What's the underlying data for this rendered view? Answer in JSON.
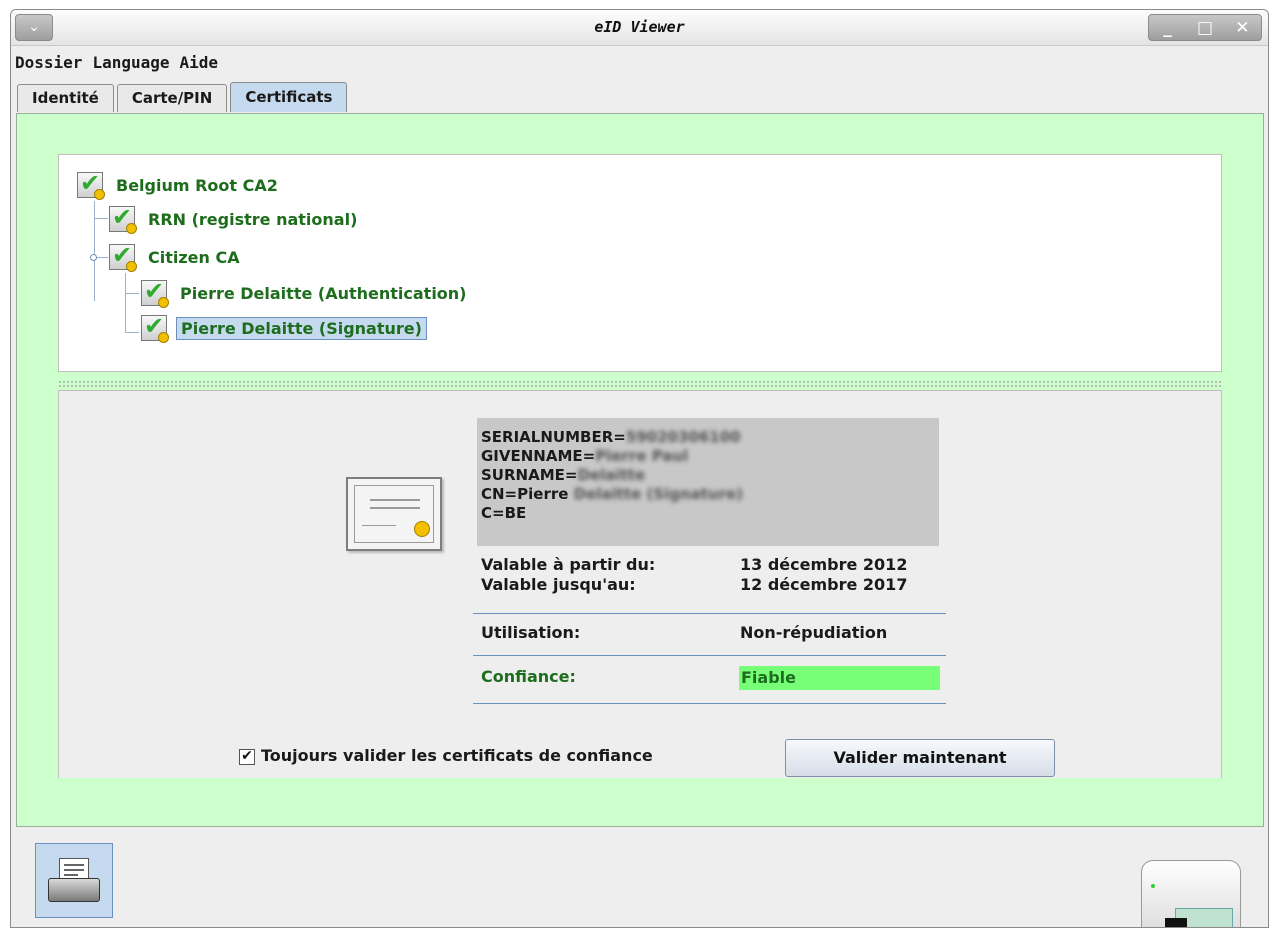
{
  "window": {
    "title": "eID Viewer",
    "menu_button_glyph": "⌄",
    "wm": {
      "minimize": "_",
      "maximize": "□",
      "close": "✕"
    }
  },
  "menubar": {
    "items": [
      "Dossier",
      "Language",
      "Aide"
    ]
  },
  "tabs": [
    {
      "label": "Identité",
      "active": false
    },
    {
      "label": "Carte/PIN",
      "active": false
    },
    {
      "label": "Certificats",
      "active": true
    }
  ],
  "tree": {
    "items": [
      {
        "label": "Belgium Root CA2",
        "level": 0,
        "icon": "cert-valid-icon"
      },
      {
        "label": "RRN (registre national)",
        "level": 1,
        "icon": "cert-valid-icon"
      },
      {
        "label": "Citizen CA",
        "level": 1,
        "icon": "cert-valid-icon"
      },
      {
        "label": "Pierre Delaitte (Authentication)",
        "level": 2,
        "icon": "cert-valid-icon"
      },
      {
        "label": "Pierre Delaitte (Signature)",
        "level": 2,
        "icon": "cert-valid-icon",
        "selected": true
      }
    ]
  },
  "details": {
    "subject": {
      "serialnumber_key": "SERIALNUMBER=",
      "serialnumber_val": "59020306100",
      "givenname_key": "GIVENNAME=",
      "givenname_val": "Pierre Paul",
      "surname_key": "SURNAME=",
      "surname_val": "Delaitte",
      "cn_key": "CN=Pierre",
      "cn_val": "Delaitte (Signature)",
      "c": "C=BE"
    },
    "valid_from_label": "Valable à partir du:",
    "valid_from": "13 décembre 2012",
    "valid_to_label": "Valable jusqu'au:",
    "valid_to": "12 décembre 2017",
    "usage_label": "Utilisation:",
    "usage": "Non-répudiation",
    "trust_label": "Confiance:",
    "trust": "Fiable",
    "trust_color": "#77ff77"
  },
  "bottom": {
    "checkbox_mark": "✔",
    "always_validate_label": "Toujours valider les certificats de confiance",
    "always_validate_checked": true,
    "validate_button": "Valider maintenant"
  },
  "colors": {
    "panel_bg": "#ccffcc",
    "tree_text": "#1d6d1d",
    "selection": "#c5d9ef"
  }
}
